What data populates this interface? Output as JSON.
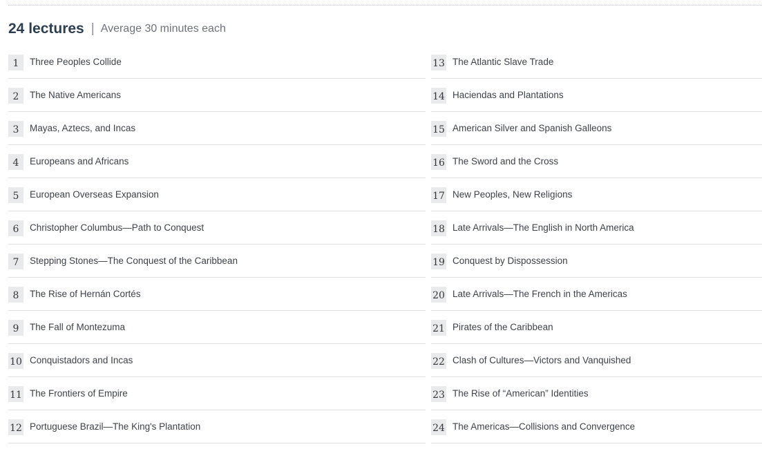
{
  "header": {
    "count_label": "24 lectures",
    "separator": "|",
    "average_label": "Average 30 minutes each"
  },
  "lectures": [
    {
      "number": "1",
      "title": "Three Peoples Collide"
    },
    {
      "number": "2",
      "title": "The Native Americans"
    },
    {
      "number": "3",
      "title": "Mayas, Aztecs, and Incas"
    },
    {
      "number": "4",
      "title": "Europeans and Africans"
    },
    {
      "number": "5",
      "title": "European Overseas Expansion"
    },
    {
      "number": "6",
      "title": "Christopher Columbus—Path to Conquest"
    },
    {
      "number": "7",
      "title": "Stepping Stones—The Conquest of the Caribbean"
    },
    {
      "number": "8",
      "title": "The Rise of Hernán Cortés"
    },
    {
      "number": "9",
      "title": "The Fall of Montezuma"
    },
    {
      "number": "10",
      "title": "Conquistadors and Incas"
    },
    {
      "number": "11",
      "title": "The Frontiers of Empire"
    },
    {
      "number": "12",
      "title": "Portuguese Brazil—The King's Plantation"
    },
    {
      "number": "13",
      "title": "The Atlantic Slave Trade"
    },
    {
      "number": "14",
      "title": "Haciendas and Plantations"
    },
    {
      "number": "15",
      "title": "American Silver and Spanish Galleons"
    },
    {
      "number": "16",
      "title": "The Sword and the Cross"
    },
    {
      "number": "17",
      "title": "New Peoples, New Religions"
    },
    {
      "number": "18",
      "title": "Late Arrivals—The English in North America"
    },
    {
      "number": "19",
      "title": "Conquest by Dispossession"
    },
    {
      "number": "20",
      "title": "Late Arrivals—The French in the Americas"
    },
    {
      "number": "21",
      "title": "Pirates of the Caribbean"
    },
    {
      "number": "22",
      "title": "Clash of Cultures—Victors and Vanquished"
    },
    {
      "number": "23",
      "title": "The Rise of “American” Identities"
    },
    {
      "number": "24",
      "title": "The Americas—Collisions and Convergence"
    }
  ]
}
